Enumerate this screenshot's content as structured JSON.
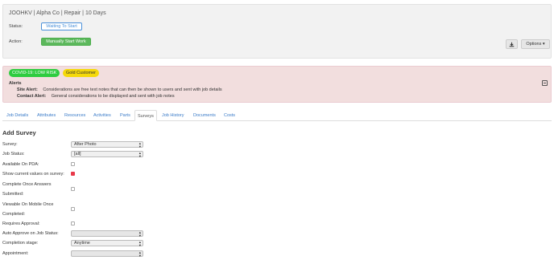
{
  "header": {
    "job_title": "JOOHKV | Alpha Co | Repair | 10 Days",
    "status_label": "Status:",
    "status_value": "Waiting To Start",
    "action_label": "Action:",
    "action_button": "Manually Start Work",
    "download_icon": "download-icon",
    "options_button": "Options ▾"
  },
  "alerts": {
    "badges": [
      "COVID-19: LOW RISK",
      "Gold Customer"
    ],
    "badge_colors": {
      "covid": "#2ecc40",
      "gold": "#f5d90a"
    },
    "title": "Alerts",
    "site_alert_label": "Site Alert:",
    "site_alert_text": "Considerations are free text notes that can then be shown to users and sent with job details",
    "contact_alert_label": "Contact Alert:",
    "contact_alert_text": "General considerations to be displayed and sent with job notes"
  },
  "tabs": [
    "Job Details",
    "Attributes",
    "Resources",
    "Activities",
    "Parts",
    "Surveys",
    "Job History",
    "Documents",
    "Costs"
  ],
  "active_tab": "Surveys",
  "form": {
    "title": "Add Survey",
    "survey_label": "Survey:",
    "survey_value": "After Photo",
    "job_status_label": "Job Status:",
    "job_status_value": "[all]",
    "available_pda_label": "Available On PDA:",
    "show_current_label": "Show current values on survey:",
    "complete_once_label_1": "Complete Once Answers",
    "complete_once_label_2": "Submitted:",
    "viewable_mobile_label_1": "Viewable On Mobile Once",
    "viewable_mobile_label_2": "Completed:",
    "requires_approval_label": "Requires Approval:",
    "auto_approve_label": "Auto Approve on Job Status:",
    "auto_approve_value": "",
    "completion_stage_label": "Completion stage:",
    "completion_stage_value": "Anytime",
    "appointment_label": "Appointment:",
    "appointment_value": "",
    "show_current_checked": true
  },
  "colors": {
    "accent": "#3a7bc8",
    "alert_bg": "#f2dede",
    "start_button": "#5cb85c"
  }
}
